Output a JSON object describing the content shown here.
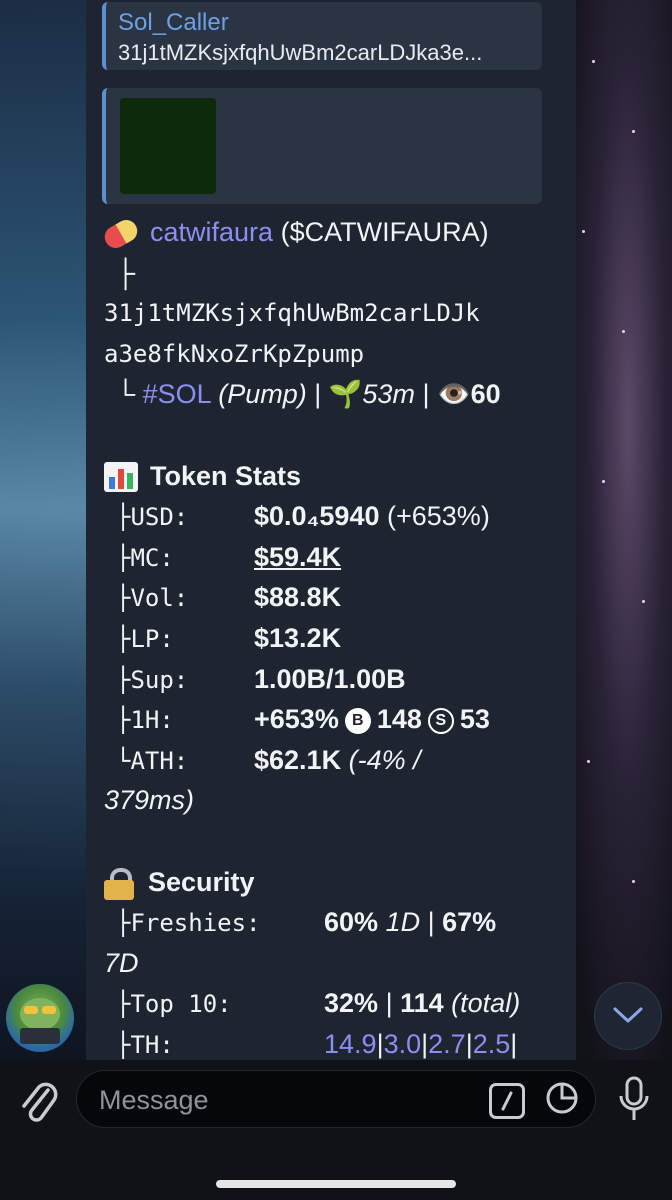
{
  "reply": {
    "name": "Sol_Caller",
    "text": "31j1tMZKsjxfqhUwBm2carLDJka3e..."
  },
  "message": {
    "token_name": "catwifaura",
    "token_ticker": "($CATWIFAURA)",
    "tree_top": "├",
    "address_line1": "31j1tMZKsjxfqhUwBm2carLDJk",
    "address_line2": "a3e8fkNxoZrKpZpump",
    "tree_end": "└",
    "chain_tag": "#SOL",
    "platform": "(Pump)",
    "sep": "|",
    "sprout_emoji": "🌱",
    "age": "53m",
    "eye_emoji": "👁️",
    "views": "60",
    "stats_header": "Token Stats",
    "stats": [
      {
        "key": "├USD:",
        "value": "$0.0₄5940",
        "extra": "(+653%)"
      },
      {
        "key": "├MC:",
        "value": "$59.4K",
        "extra": ""
      },
      {
        "key": "├Vol:",
        "value": "$88.8K",
        "extra": ""
      },
      {
        "key": "├LP:",
        "value": "$13.2K",
        "extra": ""
      },
      {
        "key": "├Sup:",
        "value": "1.00B/1.00B",
        "extra": ""
      },
      {
        "key": "├1H:",
        "value": "+653%",
        "extra": ""
      },
      {
        "key": "└ATH:",
        "value": "$62.1K",
        "extra": "(-4% /"
      }
    ],
    "h1_buys_label": "B",
    "h1_buys": "148",
    "h1_sells_label": "S",
    "h1_sells": "53",
    "ath_time": "379ms)",
    "security_header": "Security",
    "security": {
      "freshies_key": "├Freshies:",
      "freshies_1d": "60%",
      "label_1d": "1D",
      "freshies_7d": "67%",
      "label_7d": "7D",
      "top10_key": "├Top 10:",
      "top10_pct": "32%",
      "top10_count": "114",
      "top10_total": "(total)",
      "th_key": "├TH:",
      "th_values": [
        "14.9",
        "3.0",
        "2.7",
        "2.5"
      ]
    }
  },
  "composer": {
    "placeholder": "Message"
  }
}
